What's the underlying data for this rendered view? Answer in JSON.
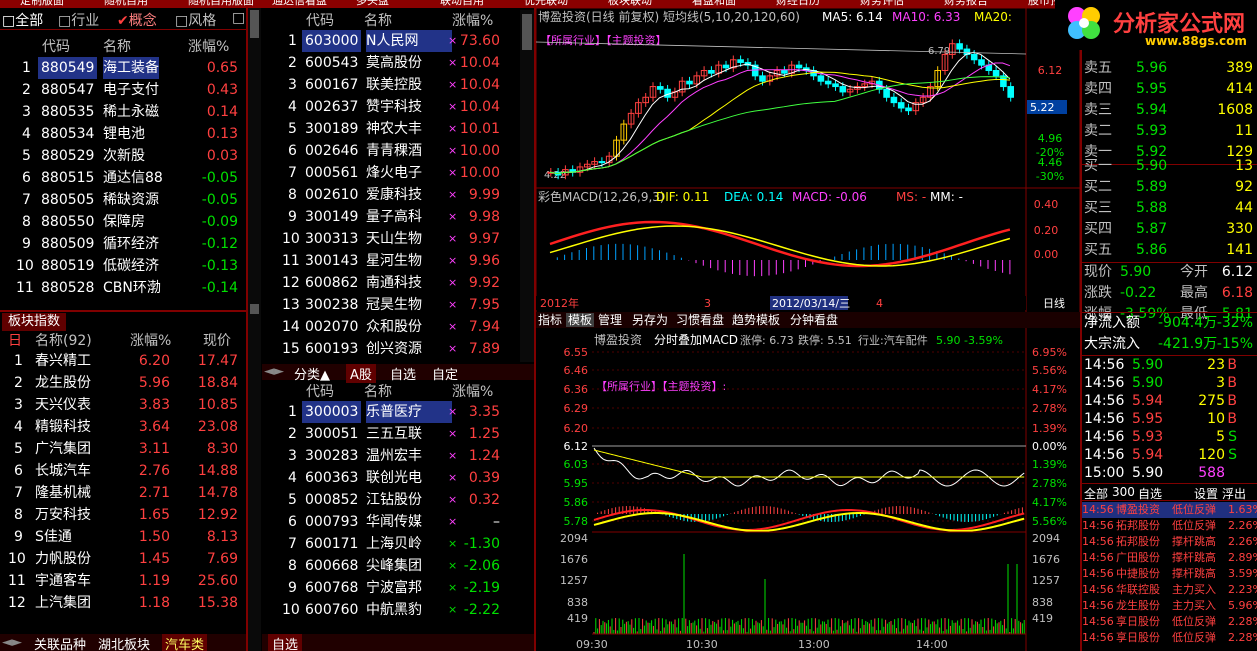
{
  "top_menu": [
    "定制版面",
    "随机自用",
    "随机自用版面",
    "通达信看盘",
    "多头盘",
    "联动自用",
    "优先联动",
    "板块联动",
    "看盘和面",
    "财经日历",
    "财务评估",
    "财务报告",
    "股市预测",
    "量中监测",
    "通达信版"
  ],
  "left_tabs": {
    "all": "全部",
    "industry": "行业",
    "concept": "概念",
    "style": "风格"
  },
  "sector_table": {
    "headers": {
      "code": "代码",
      "name": "名称",
      "change": "涨幅%"
    },
    "rows": [
      {
        "n": "1",
        "code": "880549",
        "name": "海工装备",
        "chg": "0.65",
        "c": "r"
      },
      {
        "n": "2",
        "code": "880547",
        "name": "电子支付",
        "chg": "0.43",
        "c": "r"
      },
      {
        "n": "3",
        "code": "880535",
        "name": "稀土永磁",
        "chg": "0.14",
        "c": "r"
      },
      {
        "n": "4",
        "code": "880534",
        "name": "锂电池",
        "chg": "0.13",
        "c": "r"
      },
      {
        "n": "5",
        "code": "880529",
        "name": "次新股",
        "chg": "0.03",
        "c": "r"
      },
      {
        "n": "6",
        "code": "880515",
        "name": "通达信88",
        "chg": "-0.05",
        "c": "g"
      },
      {
        "n": "7",
        "code": "880505",
        "name": "稀缺资源",
        "chg": "-0.05",
        "c": "g"
      },
      {
        "n": "8",
        "code": "880550",
        "name": "保障房",
        "chg": "-0.09",
        "c": "g"
      },
      {
        "n": "9",
        "code": "880509",
        "name": "循环经济",
        "chg": "-0.12",
        "c": "g"
      },
      {
        "n": "10",
        "code": "880519",
        "name": "低碳经济",
        "chg": "-0.13",
        "c": "g"
      },
      {
        "n": "11",
        "code": "880528",
        "name": "CBN环渤",
        "chg": "-0.14",
        "c": "g"
      }
    ]
  },
  "index_panel": {
    "title": "板块指数",
    "headers": {
      "name": "名称(92)",
      "change": "涨幅%",
      "price": "现价"
    },
    "rows": [
      {
        "n": "1",
        "name": "春兴精工",
        "chg": "6.20",
        "px": "17.47"
      },
      {
        "n": "2",
        "name": "龙生股份",
        "chg": "5.96",
        "px": "18.84"
      },
      {
        "n": "3",
        "name": "天兴仪表",
        "chg": "3.83",
        "px": "10.85"
      },
      {
        "n": "4",
        "name": "精锻科技",
        "chg": "3.64",
        "px": "23.08"
      },
      {
        "n": "5",
        "name": "广汽集团",
        "chg": "3.11",
        "px": "8.30"
      },
      {
        "n": "6",
        "name": "长城汽车",
        "chg": "2.76",
        "px": "14.88"
      },
      {
        "n": "7",
        "name": "隆基机械",
        "chg": "2.71",
        "px": "14.78"
      },
      {
        "n": "8",
        "name": "万安科技",
        "chg": "1.65",
        "px": "12.92"
      },
      {
        "n": "9",
        "name": "S佳通",
        "chg": "1.50",
        "px": "8.13"
      },
      {
        "n": "10",
        "name": "力帆股份",
        "chg": "1.45",
        "px": "7.69"
      },
      {
        "n": "11",
        "name": "宇通客车",
        "chg": "1.19",
        "px": "25.60"
      },
      {
        "n": "12",
        "name": "上汽集团",
        "chg": "1.18",
        "px": "15.38"
      }
    ],
    "bottom_tabs": [
      "关联品种",
      "湖北板块",
      "汽车类"
    ]
  },
  "rank_top": {
    "headers": {
      "code": "代码",
      "name": "名称",
      "change": "涨幅%"
    },
    "rows": [
      {
        "n": "1",
        "code": "603000",
        "name": "N人民网",
        "chg": "73.60",
        "c": "r"
      },
      {
        "n": "2",
        "code": "600543",
        "name": "莫高股份",
        "chg": "10.04",
        "c": "r"
      },
      {
        "n": "3",
        "code": "600167",
        "name": "联美控股",
        "chg": "10.04",
        "c": "r"
      },
      {
        "n": "4",
        "code": "002637",
        "name": "赞宇科技",
        "chg": "10.04",
        "c": "r"
      },
      {
        "n": "5",
        "code": "300189",
        "name": "神农大丰",
        "chg": "10.01",
        "c": "r"
      },
      {
        "n": "6",
        "code": "002646",
        "name": "青青稞酒",
        "chg": "10.00",
        "c": "r"
      },
      {
        "n": "7",
        "code": "000561",
        "name": "烽火电子",
        "chg": "10.00",
        "c": "r"
      },
      {
        "n": "8",
        "code": "002610",
        "name": "爱康科技",
        "chg": "9.99",
        "c": "r"
      },
      {
        "n": "9",
        "code": "300149",
        "name": "量子高科",
        "chg": "9.98",
        "c": "r"
      },
      {
        "n": "10",
        "code": "300313",
        "name": "天山生物",
        "chg": "9.97",
        "c": "r"
      },
      {
        "n": "11",
        "code": "300143",
        "name": "星河生物",
        "chg": "9.96",
        "c": "r"
      },
      {
        "n": "12",
        "code": "600862",
        "name": "南通科技",
        "chg": "9.92",
        "c": "r"
      },
      {
        "n": "13",
        "code": "300238",
        "name": "冠昊生物",
        "chg": "7.95",
        "c": "r"
      },
      {
        "n": "14",
        "code": "002070",
        "name": "众和股份",
        "chg": "7.94",
        "c": "r"
      },
      {
        "n": "15",
        "code": "600193",
        "name": "创兴资源",
        "chg": "7.89",
        "c": "r"
      }
    ],
    "tabs": [
      "分类▲",
      "A股",
      "自选",
      "自定"
    ]
  },
  "rank_bottom": {
    "headers": {
      "code": "代码",
      "name": "名称",
      "change": "涨幅%"
    },
    "rows": [
      {
        "n": "1",
        "code": "300003",
        "name": "乐普医疗",
        "chg": "3.35",
        "c": "r"
      },
      {
        "n": "2",
        "code": "300051",
        "name": "三五互联",
        "chg": "1.25",
        "c": "r"
      },
      {
        "n": "3",
        "code": "300283",
        "name": "温州宏丰",
        "chg": "1.24",
        "c": "r"
      },
      {
        "n": "4",
        "code": "600363",
        "name": "联创光电",
        "chg": "0.39",
        "c": "r"
      },
      {
        "n": "5",
        "code": "000852",
        "name": "江钻股份",
        "chg": "0.32",
        "c": "r"
      },
      {
        "n": "6",
        "code": "000793",
        "name": "华闻传媒",
        "chg": "–",
        "c": "w"
      },
      {
        "n": "7",
        "code": "600171",
        "name": "上海贝岭",
        "chg": "-1.30",
        "c": "g"
      },
      {
        "n": "8",
        "code": "600668",
        "name": "尖峰集团",
        "chg": "-2.06",
        "c": "g"
      },
      {
        "n": "9",
        "code": "600768",
        "name": "宁波富邦",
        "chg": "-2.19",
        "c": "g"
      },
      {
        "n": "10",
        "code": "600760",
        "name": "中航黑豹",
        "chg": "-2.22",
        "c": "g"
      }
    ],
    "tab": "自选"
  },
  "kline": {
    "title": "博盈投资(日线 前复权) 短均线(5,10,20,120,60)",
    "ma5": "MA5: 6.14",
    "ma10": "MA10: 6.33",
    "ma20": "MA20:",
    "annot": "【所属行业】【主题投资】",
    "price_labels": [
      "6.12",
      "4.96",
      "4.46",
      "4.22"
    ],
    "pct_labels": [
      "-20%",
      "-30%"
    ],
    "current": "5.22",
    "peak": "6.79",
    "low": "4.22",
    "macd_title": "彩色MACD(12,26,9,3)",
    "dif": "DIF: 0.11",
    "dea": "DEA: 0.14",
    "macd": "MACD: -0.06",
    "ms": "MS: -",
    "mm": "MM: -",
    "macd_labels": [
      "0.40",
      "0.20",
      "0.00"
    ],
    "axis": {
      "year": "2012年",
      "m3": "3",
      "date": "2012/03/14/三",
      "m4": "4",
      "period": "日线"
    }
  },
  "chart_tabs": [
    "指标",
    "模板",
    "管理",
    "另存为",
    "习惯看盘",
    "趋势模板",
    "分钟看盘"
  ],
  "intraday": {
    "title": "博盈投资",
    "sub": "分时叠加MACD",
    "up": "涨停: 6.73",
    "down": "跌停: 5.51",
    "ind": "行业:汽车配件",
    "last": "5.90",
    "pct": "-3.59%",
    "annot": "【所属行业】【主题投资】:",
    "prices": [
      "6.55",
      "6.46",
      "6.36",
      "6.29",
      "6.20",
      "6.12",
      "6.03",
      "5.95",
      "5.86",
      "5.78"
    ],
    "pcts": [
      "6.95%",
      "5.56%",
      "4.17%",
      "2.78%",
      "1.39%",
      "0.00%",
      "1.39%",
      "2.78%",
      "4.17%",
      "5.56%"
    ],
    "vols": [
      "2094",
      "1676",
      "1257",
      "838",
      "419"
    ],
    "times": [
      "09:30",
      "10:30",
      "13:00",
      "14:00"
    ]
  },
  "quote": {
    "sells": [
      {
        "l": "卖五",
        "p": "5.96",
        "v": "389"
      },
      {
        "l": "卖四",
        "p": "5.95",
        "v": "414"
      },
      {
        "l": "卖三",
        "p": "5.94",
        "v": "1608"
      },
      {
        "l": "卖二",
        "p": "5.93",
        "v": "11"
      },
      {
        "l": "卖一",
        "p": "5.92",
        "v": "129"
      }
    ],
    "buys": [
      {
        "l": "买一",
        "p": "5.90",
        "v": "13"
      },
      {
        "l": "买二",
        "p": "5.89",
        "v": "92"
      },
      {
        "l": "买三",
        "p": "5.88",
        "v": "44"
      },
      {
        "l": "买四",
        "p": "5.87",
        "v": "330"
      },
      {
        "l": "买五",
        "p": "5.86",
        "v": "141"
      }
    ],
    "stats": [
      {
        "a": "现价",
        "b": "5.90",
        "c": "今开",
        "d": "6.12"
      },
      {
        "a": "涨跌",
        "b": "-0.22",
        "c": "最高",
        "d": "6.18"
      },
      {
        "a": "涨幅",
        "b": "-3.59%",
        "c": "最低",
        "d": "5.81"
      }
    ],
    "flow": [
      {
        "a": "净流入额",
        "b": "-904.4万",
        "c": "-32%"
      },
      {
        "a": "大宗流入",
        "b": "-421.9万",
        "c": "-15%"
      }
    ],
    "ticks": [
      {
        "t": "14:56",
        "p": "5.90",
        "v": "23",
        "d": "B"
      },
      {
        "t": "14:56",
        "p": "5.90",
        "v": "3",
        "d": "B"
      },
      {
        "t": "14:56",
        "p": "5.94",
        "v": "275",
        "d": "B"
      },
      {
        "t": "14:56",
        "p": "5.95",
        "v": "10",
        "d": "B"
      },
      {
        "t": "14:56",
        "p": "5.93",
        "v": "5",
        "d": "S"
      },
      {
        "t": "14:56",
        "p": "5.94",
        "v": "120",
        "d": "S"
      },
      {
        "t": "15:00",
        "p": "5.90",
        "v": "588",
        "d": ""
      }
    ],
    "tabs": [
      "全部",
      "300",
      "自选",
      "设置",
      "浮出"
    ],
    "alerts": [
      {
        "t": "14:56",
        "n": "博盈投资",
        "e": "低位反弹",
        "v": "1.63%"
      },
      {
        "t": "14:56",
        "n": "拓邦股份",
        "e": "低位反弹",
        "v": "2.26%"
      },
      {
        "t": "14:56",
        "n": "拓邦股份",
        "e": "撑杆跳高",
        "v": "2.26%"
      },
      {
        "t": "14:56",
        "n": "广田股份",
        "e": "撑杆跳高",
        "v": "2.89%"
      },
      {
        "t": "14:56",
        "n": "中捷股份",
        "e": "撑杆跳高",
        "v": "3.59%"
      },
      {
        "t": "14:56",
        "n": "华联控股",
        "e": "主力买入",
        "v": "2.23%"
      },
      {
        "t": "14:56",
        "n": "龙生股份",
        "e": "主力买入",
        "v": "5.96%"
      },
      {
        "t": "14:56",
        "n": "享日股份",
        "e": "低位反弹",
        "v": "2.28%"
      },
      {
        "t": "14:56",
        "n": "享日股份",
        "e": "低位反弹",
        "v": "2.28%"
      }
    ]
  },
  "logo": {
    "text": "分析家公式网",
    "url": "www.88gs.com"
  }
}
